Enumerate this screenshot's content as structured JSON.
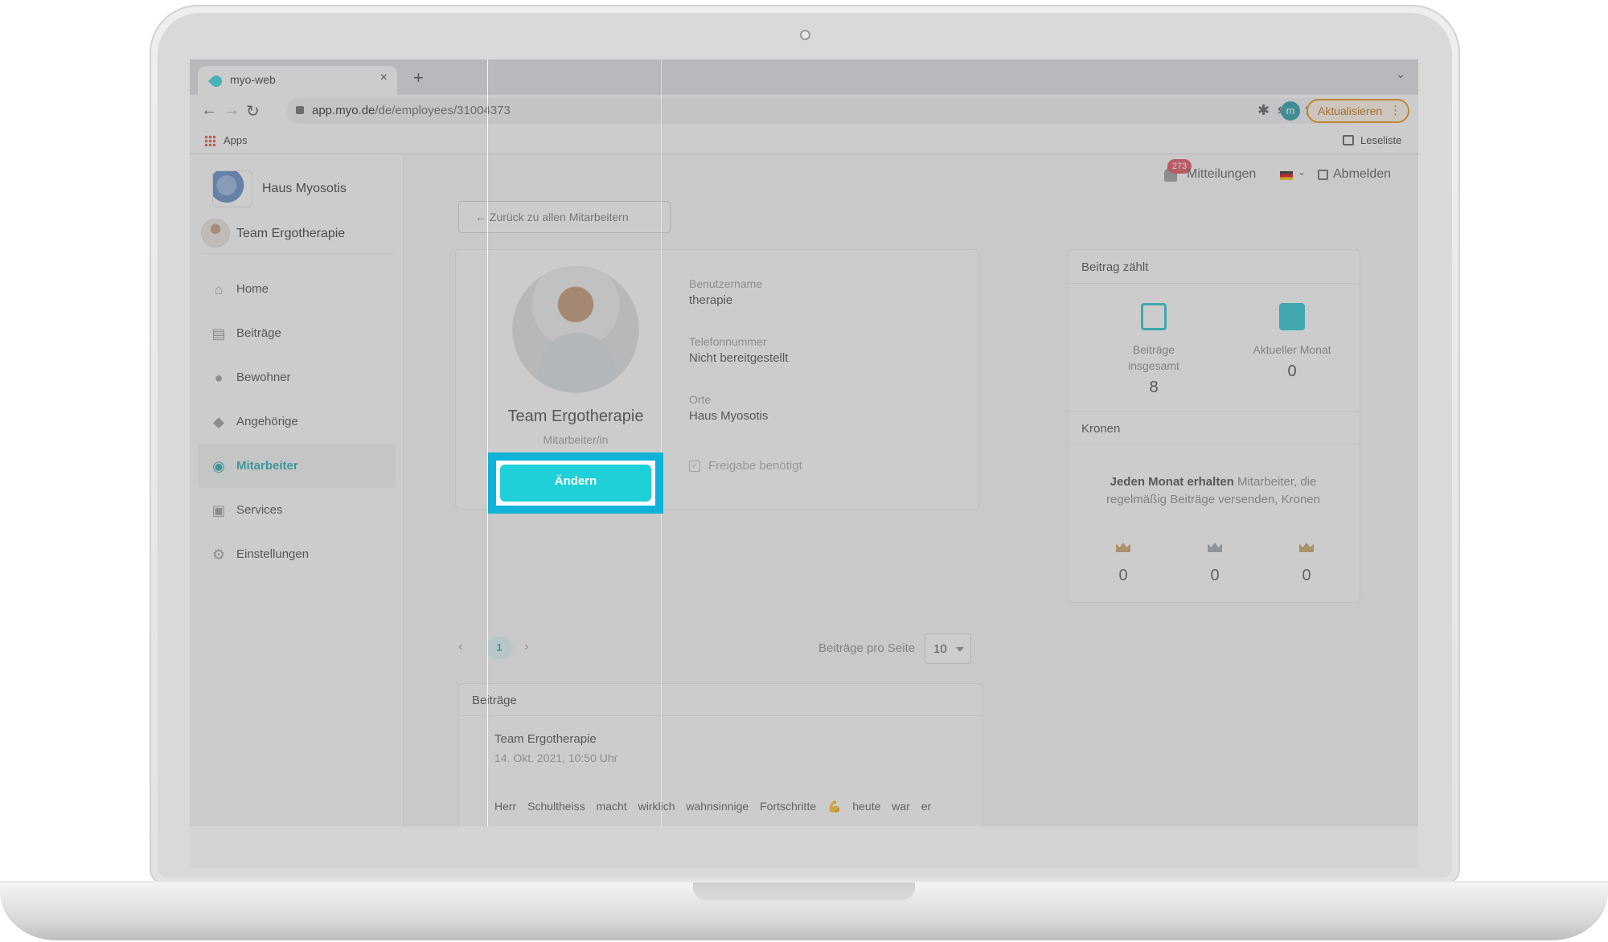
{
  "browser": {
    "tab_title": "myo-web",
    "tab_close": "×",
    "new_tab": "+",
    "tab_menu": "⌄",
    "url_host": "app.myo.de",
    "url_path": "/de/employees/31004373",
    "profile_initial": "m",
    "update_label": "Aktualisieren",
    "bookmarks": {
      "apps": "Apps",
      "reading_list": "Leseliste"
    }
  },
  "sidebar": {
    "org_name": "Haus Myosotis",
    "team_name": "Team Ergotherapie",
    "items": [
      {
        "label": "Home",
        "icon": "home-icon",
        "active": false
      },
      {
        "label": "Beiträge",
        "icon": "clipboard-icon",
        "active": false
      },
      {
        "label": "Bewohner",
        "icon": "person-icon",
        "active": false
      },
      {
        "label": "Angehörige",
        "icon": "people-icon",
        "active": false
      },
      {
        "label": "Mitarbeiter",
        "icon": "employee-icon",
        "active": true
      },
      {
        "label": "Services",
        "icon": "services-icon",
        "active": false
      },
      {
        "label": "Einstellungen",
        "icon": "gear-icon",
        "active": false
      }
    ]
  },
  "topbar": {
    "notifications_count": "273",
    "notifications_label": "Mitteilungen",
    "logout_label": "Abmelden"
  },
  "back_button": "← Zurück zu allen Mitarbeitern",
  "profile": {
    "name": "Team Ergotherapie",
    "role": "Mitarbeiter/in",
    "edit_label": "Ändern",
    "username_label": "Benutzername",
    "username_value": "therapie",
    "phone_label": "Telefonnummer",
    "phone_value": "Nicht bereitgestellt",
    "locations_label": "Orte",
    "locations_value": "Haus Myosotis",
    "approval_label": "Freigabe benötigt"
  },
  "stats": {
    "title": "Beitrag zählt",
    "total_label": "Beiträge insgesamt",
    "total_value": "8",
    "month_label": "Aktueller Monat",
    "month_value": "0",
    "crowns_title": "Kronen",
    "crowns_bold": "Jeden Monat erhalten",
    "crowns_text": " Mitarbeiter, die regelmäßig Beiträge versenden, Kronen",
    "crowns": [
      {
        "value": "0",
        "color": "#c9a062"
      },
      {
        "value": "0",
        "color": "#9ea3ab"
      },
      {
        "value": "0",
        "color": "#c9a062"
      }
    ]
  },
  "pagination": {
    "prev": "‹",
    "current": "1",
    "next": "›",
    "per_page_label": "Beiträge pro Seite",
    "per_page_value": "10"
  },
  "posts": {
    "title": "Beiträge",
    "items": [
      {
        "author": "Team Ergotherapie",
        "date": "14. Okt. 2021, 10:50 Uhr",
        "text": "Herr Schultheiss macht wirklich wahnsinnige Fortschritte 💪 heute war er"
      }
    ]
  },
  "colors": {
    "accent": "#1fd0d8",
    "highlight": "#0fb2d8",
    "badge": "#e04a5a"
  }
}
